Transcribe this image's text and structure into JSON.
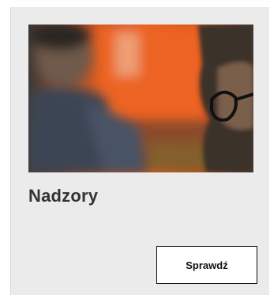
{
  "card": {
    "image_description_icon": "photo-people-meeting",
    "title": "Nadzory",
    "button_label": "Sprawdź"
  },
  "colors": {
    "card_background": "#ebebeb",
    "title_text": "#333333",
    "button_border": "#111111",
    "photo_accent": "#e8581c"
  }
}
